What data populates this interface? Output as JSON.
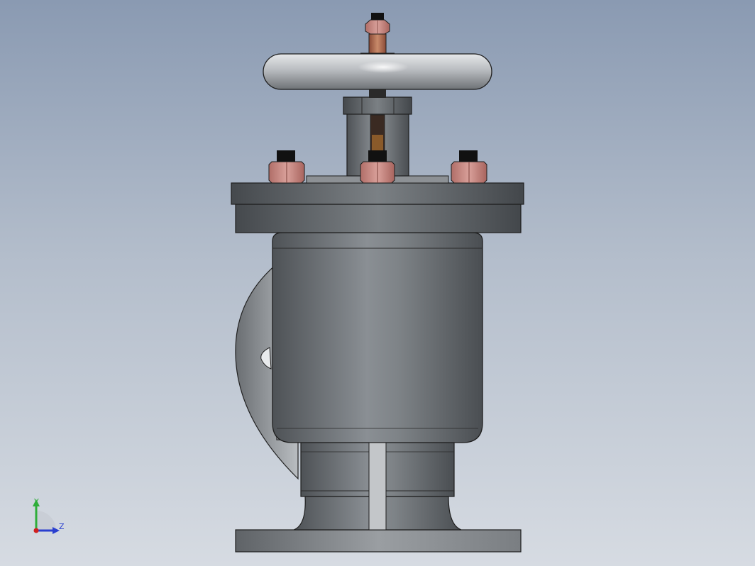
{
  "viewport": {
    "background_top": "#8a9ab2",
    "background_bottom": "#d6dbe2"
  },
  "model": {
    "part": "angle-valve-assembly",
    "body_color": "#6f7377",
    "bolt_color": "#c9847e",
    "stem_color": "#b06a4a",
    "handwheel_color": "#c9ccd0"
  },
  "triad": {
    "y_label": "Y",
    "z_label": "Z",
    "y_color": "#2fae3a",
    "z_color": "#2a3fcf",
    "x_color": "#d02020"
  }
}
